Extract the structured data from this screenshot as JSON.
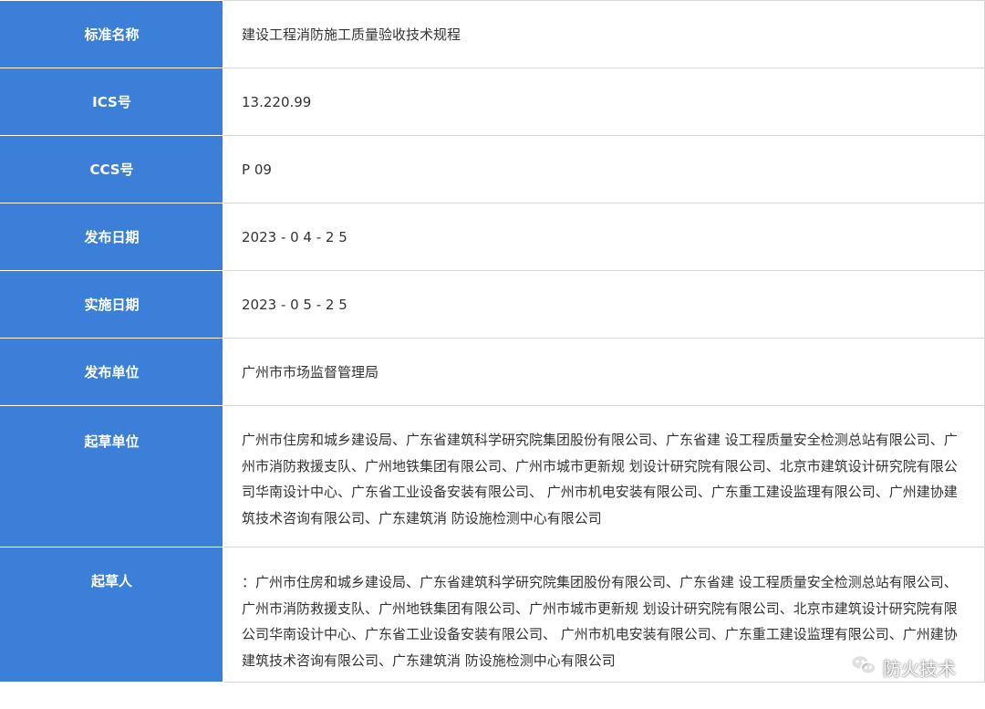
{
  "rows": [
    {
      "label": "标准名称",
      "value": "建设工程消防施工质量验收技术规程"
    },
    {
      "label": "ICS号",
      "value": "13.220.99"
    },
    {
      "label": "CCS号",
      "value": "P 09"
    },
    {
      "label": "发布日期",
      "value": "2023 - 0 4 - 2 5"
    },
    {
      "label": "实施日期",
      "value": "2023 - 0 5 - 2 5"
    },
    {
      "label": "发布单位",
      "value": "广州市市场监督管理局"
    },
    {
      "label": "起草单位",
      "value": "广州市住房和城乡建设局、广东省建筑科学研究院集团股份有限公司、广东省建 设工程质量安全检测总站有限公司、广州市消防救援支队、广州地铁集团有限公司、广州市城市更新规 划设计研究院有限公司、北京市建筑设计研究院有限公司华南设计中心、广东省工业设备安装有限公司、 广州市机电安装有限公司、广东重工建设监理有限公司、广州建协建筑技术咨询有限公司、广东建筑消 防设施检测中心有限公司"
    },
    {
      "label": "起草人",
      "value": "：广州市住房和城乡建设局、广东省建筑科学研究院集团股份有限公司、广东省建 设工程质量安全检测总站有限公司、广州市消防救援支队、广州地铁集团有限公司、广州市城市更新规 划设计研究院有限公司、北京市建筑设计研究院有限公司华南设计中心、广东省工业设备安装有限公司、 广州市机电安装有限公司、广东重工建设监理有限公司、广州建协建筑技术咨询有限公司、广东建筑消 防设施检测中心有限公司"
    }
  ],
  "watermark": {
    "text": "防火技术",
    "icon": "wechat-icon"
  }
}
